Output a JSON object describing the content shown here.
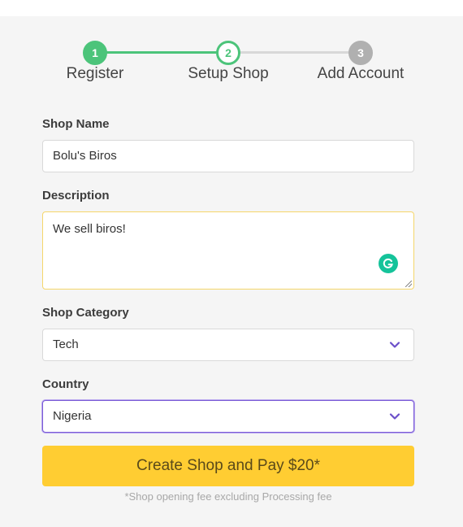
{
  "stepper": {
    "steps": [
      {
        "number": "1",
        "label": "Register",
        "state": "complete"
      },
      {
        "number": "2",
        "label": "Setup Shop",
        "state": "current"
      },
      {
        "number": "3",
        "label": "Add Account",
        "state": "pending"
      }
    ]
  },
  "form": {
    "shop_name": {
      "label": "Shop Name",
      "value": "Bolu's Biros"
    },
    "description": {
      "label": "Description",
      "value": "We sell biros!"
    },
    "category": {
      "label": "Shop Category",
      "value": "Tech"
    },
    "country": {
      "label": "Country",
      "value": "Nigeria"
    },
    "submit_label": "Create Shop and Pay $20*",
    "fee_note": "*Shop opening fee excluding Processing fee"
  },
  "colors": {
    "accent_green": "#4cc47a",
    "accent_yellow": "#ffcd32",
    "accent_purple": "#7b5cd6",
    "grammarly": "#15c39a"
  },
  "icons": {
    "grammarly": "grammarly-icon",
    "select_arrow": "chevron-down-icon"
  }
}
